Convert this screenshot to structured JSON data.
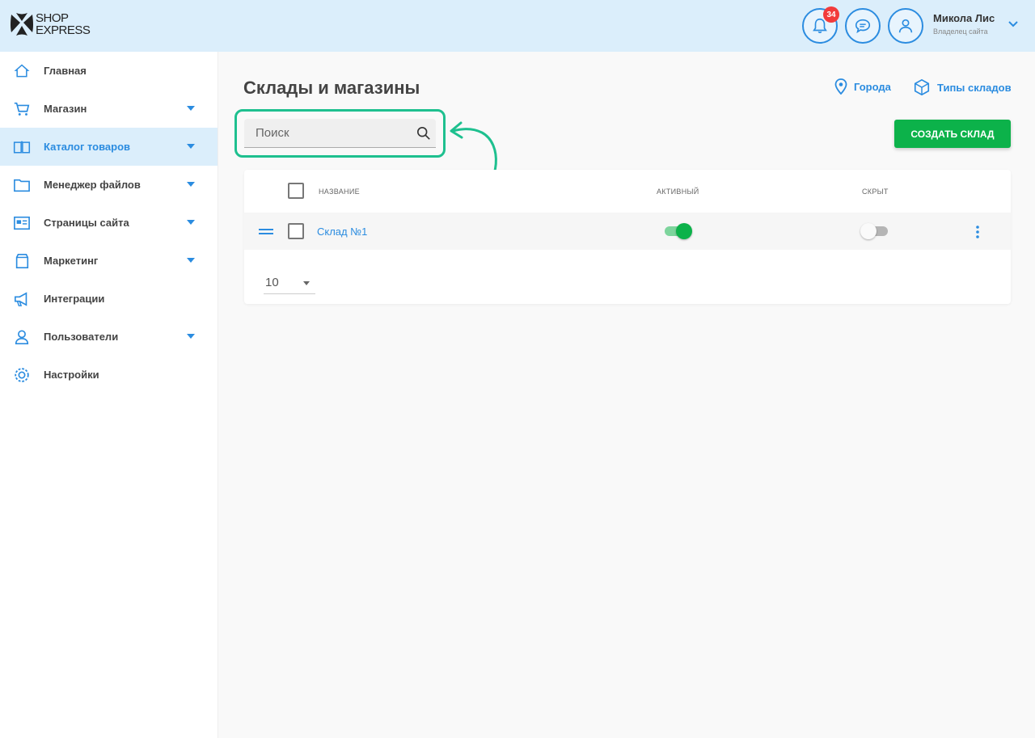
{
  "header": {
    "logo_top": "SHOP",
    "logo_bottom": "EXPRESS",
    "notifications_count": "34",
    "user_name": "Микола Лис",
    "user_role": "Владелец сайта"
  },
  "sidebar": {
    "items": [
      {
        "label": "Главная",
        "icon": "home-icon",
        "has_submenu": false,
        "active": false
      },
      {
        "label": "Магазин",
        "icon": "cart-icon",
        "has_submenu": true,
        "active": false
      },
      {
        "label": "Каталог товаров",
        "icon": "book-icon",
        "has_submenu": true,
        "active": true
      },
      {
        "label": "Менеджер файлов",
        "icon": "folder-icon",
        "has_submenu": true,
        "active": false
      },
      {
        "label": "Страницы сайта",
        "icon": "page-icon",
        "has_submenu": true,
        "active": false
      },
      {
        "label": "Маркетинг",
        "icon": "marketing-icon",
        "has_submenu": true,
        "active": false
      },
      {
        "label": "Интеграции",
        "icon": "megaphone-icon",
        "has_submenu": false,
        "active": false
      },
      {
        "label": "Пользователи",
        "icon": "users-icon",
        "has_submenu": true,
        "active": false
      },
      {
        "label": "Настройки",
        "icon": "gear-icon",
        "has_submenu": false,
        "active": false
      }
    ]
  },
  "main": {
    "title": "Склады и магазины",
    "link_cities": "Города",
    "link_types": "Типы складов",
    "search_placeholder": "Поиск",
    "create_button": "СОЗДАТЬ СКЛАД",
    "table": {
      "columns": [
        "Название",
        "Активный",
        "Скрыт"
      ],
      "rows": [
        {
          "name": "Склад №1",
          "active": true,
          "hidden": false
        }
      ]
    },
    "per_page": "10"
  },
  "colors": {
    "accent": "#2b8ce0",
    "primary_button": "#0cb24a",
    "highlight": "#1ec08f",
    "header_bg": "#dbeefb"
  }
}
